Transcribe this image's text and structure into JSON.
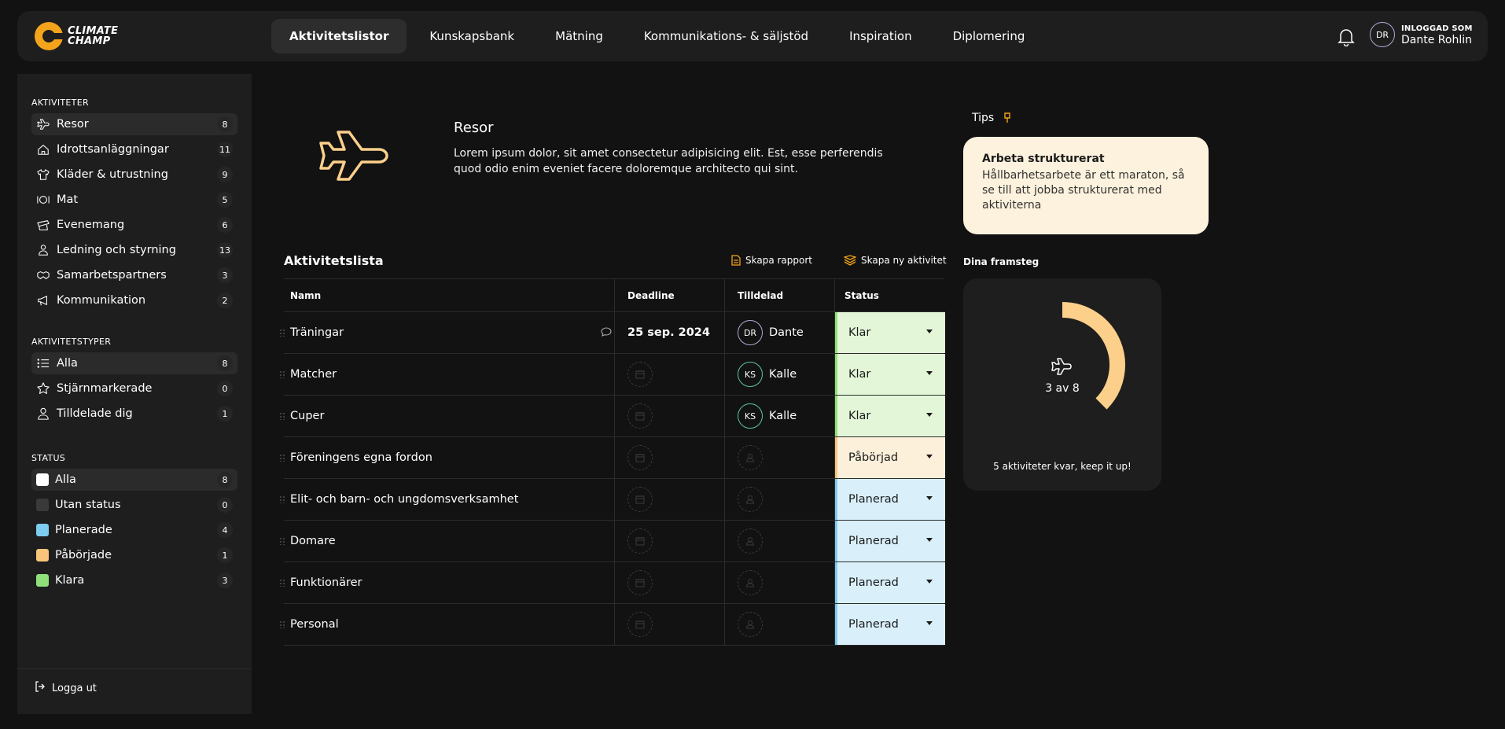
{
  "brand": {
    "line1": "CLIMATE",
    "line2": "CHAMP"
  },
  "nav": {
    "items": [
      {
        "label": "Aktivitetslistor",
        "active": true
      },
      {
        "label": "Kunskapsbank"
      },
      {
        "label": "Mätning"
      },
      {
        "label": "Kommunikations- & säljstöd"
      },
      {
        "label": "Inspiration"
      },
      {
        "label": "Diplomering"
      }
    ]
  },
  "user": {
    "initials": "DR",
    "label": "INLOGGAD SOM",
    "name": "Dante Rohlin"
  },
  "sidebar": {
    "activities_title": "AKTIVITETER",
    "activities": [
      {
        "label": "Resor",
        "count": "8",
        "icon": "plane-icon",
        "active": true
      },
      {
        "label": "Idrottsanläggningar",
        "count": "11",
        "icon": "home-icon"
      },
      {
        "label": "Kläder & utrustning",
        "count": "9",
        "icon": "shirt-icon"
      },
      {
        "label": "Mat",
        "count": "5",
        "icon": "plate-icon"
      },
      {
        "label": "Evenemang",
        "count": "6",
        "icon": "ticket-icon"
      },
      {
        "label": "Ledning och styrning",
        "count": "13",
        "icon": "leader-icon"
      },
      {
        "label": "Samarbetspartners",
        "count": "3",
        "icon": "handshake-icon"
      },
      {
        "label": "Kommunikation",
        "count": "2",
        "icon": "megaphone-icon"
      }
    ],
    "types_title": "AKTIVITETSTYPER",
    "types": [
      {
        "label": "Alla",
        "count": "8",
        "icon": "list-icon",
        "active": true
      },
      {
        "label": "Stjärnmarkerade",
        "count": "0",
        "icon": "star-icon"
      },
      {
        "label": "Tilldelade dig",
        "count": "1",
        "icon": "person-icon"
      }
    ],
    "status_title": "STATUS",
    "statuses": [
      {
        "label": "Alla",
        "count": "8",
        "color": "#ffffff",
        "active": true
      },
      {
        "label": "Utan status",
        "count": "0",
        "color": "#3a3a3a"
      },
      {
        "label": "Planerade",
        "count": "4",
        "color": "#7ccdf0"
      },
      {
        "label": "Påbörjade",
        "count": "1",
        "color": "#f9c57a"
      },
      {
        "label": "Klara",
        "count": "3",
        "color": "#8fe07a"
      }
    ],
    "logout": "Logga ut"
  },
  "hero": {
    "title": "Resor",
    "description": "Lorem ipsum dolor, sit amet consectetur adipisicing elit. Est, esse perferendis quod odio enim eveniet facere doloremque architecto qui sint."
  },
  "tips": {
    "label": "Tips",
    "card_title": "Arbeta strukturerat",
    "card_text": "Hållbarhetsarbete är ett maraton, så se till att jobba strukturerat med aktiviterna"
  },
  "list": {
    "title": "Aktivitetslista",
    "report_button": "Skapa rapport",
    "new_button": "Skapa ny aktivitet",
    "headers": {
      "name": "Namn",
      "deadline": "Deadline",
      "assigned": "Tilldelad",
      "status": "Status"
    },
    "rows": [
      {
        "name": "Träningar",
        "deadline": "25 sep. 2024",
        "initials": "DR",
        "assignee": "Dante",
        "avatar": "purple",
        "status": "Klar",
        "st": "klar",
        "comment": true
      },
      {
        "name": "Matcher",
        "deadline": "",
        "initials": "KS",
        "assignee": "Kalle",
        "avatar": "green",
        "status": "Klar",
        "st": "klar"
      },
      {
        "name": "Cuper",
        "deadline": "",
        "initials": "KS",
        "assignee": "Kalle",
        "avatar": "green",
        "status": "Klar",
        "st": "klar"
      },
      {
        "name": "Föreningens egna fordon",
        "deadline": "",
        "initials": "",
        "assignee": "",
        "status": "Påbörjad",
        "st": "pab"
      },
      {
        "name": "Elit- och barn- och ungdomsverksamhet",
        "deadline": "",
        "initials": "",
        "assignee": "",
        "status": "Planerad",
        "st": "plan"
      },
      {
        "name": "Domare",
        "deadline": "",
        "initials": "",
        "assignee": "",
        "status": "Planerad",
        "st": "plan"
      },
      {
        "name": "Funktionärer",
        "deadline": "",
        "initials": "",
        "assignee": "",
        "status": "Planerad",
        "st": "plan"
      },
      {
        "name": "Personal",
        "deadline": "",
        "initials": "",
        "assignee": "",
        "status": "Planerad",
        "st": "plan"
      }
    ]
  },
  "progress": {
    "label": "Dina framsteg",
    "done": 3,
    "total": 8,
    "count_text": "3 av 8",
    "message": "5 aktiviteter kvar, keep it up!",
    "color": "#fcd08a"
  }
}
